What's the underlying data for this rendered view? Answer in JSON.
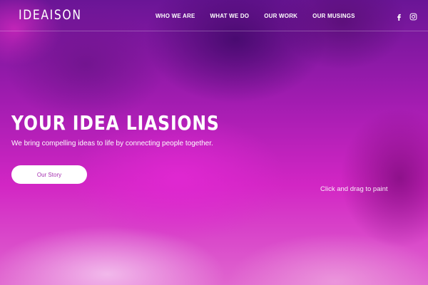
{
  "brand": {
    "logo_text": "IDEAISON"
  },
  "nav": {
    "items": [
      {
        "label": "WHO WE ARE"
      },
      {
        "label": "WHAT WE DO"
      },
      {
        "label": "OUR WORK"
      },
      {
        "label": "OUR MUSINGS"
      }
    ],
    "social": [
      {
        "icon": "facebook-icon"
      },
      {
        "icon": "instagram-icon"
      }
    ]
  },
  "hero": {
    "title": "YOUR IDEA LIASIONS",
    "subtitle": "We bring compelling ideas to life by connecting people together.",
    "cta_label": "Our Story",
    "hint": "Click and drag to paint"
  },
  "colors": {
    "background_primary": "#c21fb4",
    "background_dark": "#6a1596",
    "button_text": "#a52fb0",
    "text": "#ffffff"
  }
}
